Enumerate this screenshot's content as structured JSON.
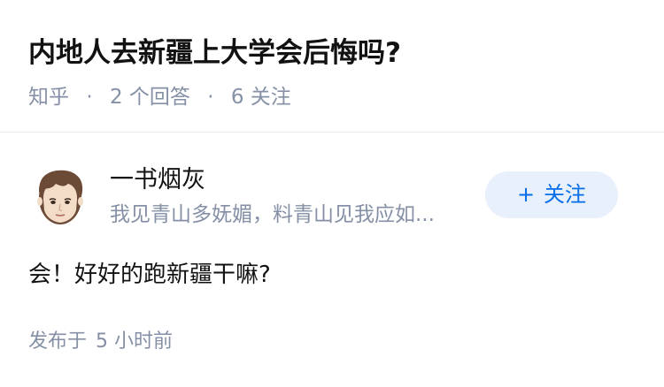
{
  "question": {
    "title": "内地人去新疆上大学会后悔吗?",
    "source": "知乎",
    "separator": "·",
    "answer_count": "2",
    "answer_label": "个回答",
    "follower_count": "6",
    "follower_label": "关注"
  },
  "answer": {
    "author": {
      "name": "一书烟灰",
      "bio": "我见青山多妩媚，料青山见我应如..."
    },
    "follow_button": {
      "icon": "plus-icon",
      "plus": "+",
      "label": "关注"
    },
    "content": "会！好好的跑新疆干嘛?",
    "time": {
      "prefix": "发布于",
      "value": "5",
      "unit": "小时前"
    }
  },
  "colors": {
    "title": "#121212",
    "meta": "#8590a6",
    "accent": "#056de8",
    "follow_bg": "#e8f0fb",
    "divider": "#ebebeb"
  }
}
